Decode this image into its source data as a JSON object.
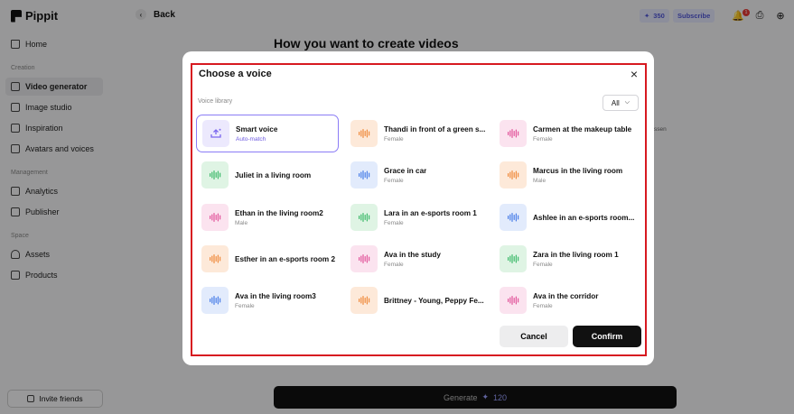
{
  "app": {
    "logo_text": "Pippit",
    "back_label": "Back",
    "credits": "350",
    "subscribe_label": "Subscribe",
    "notification_count": "1",
    "page_title": "How you want to create videos",
    "generate_label": "Generate",
    "generate_cost": "120",
    "invite_label": "Invite friends",
    "side_peek_text": "ssen"
  },
  "sidebar": {
    "home": "Home",
    "creation_section": "Creation",
    "creation": [
      {
        "label": "Video generator",
        "icon": "video-icon",
        "active": true
      },
      {
        "label": "Image studio",
        "icon": "image-icon",
        "active": false
      },
      {
        "label": "Inspiration",
        "icon": "inspiration-icon",
        "active": false
      },
      {
        "label": "Avatars and voices",
        "icon": "avatar-icon",
        "active": false
      }
    ],
    "management_section": "Management",
    "management": [
      {
        "label": "Analytics",
        "icon": "analytics-icon"
      },
      {
        "label": "Publisher",
        "icon": "calendar-icon"
      }
    ],
    "space_section": "Space",
    "space": [
      {
        "label": "Assets",
        "icon": "assets-icon"
      },
      {
        "label": "Products",
        "icon": "products-icon"
      }
    ]
  },
  "modal": {
    "title": "Choose a voice",
    "library_label": "Voice library",
    "filter_value": "All",
    "cancel_label": "Cancel",
    "confirm_label": "Confirm",
    "voices": [
      {
        "name": "Smart voice",
        "sub": "Auto-match",
        "color": "purple",
        "selected": true
      },
      {
        "name": "Thandi in front of a green s...",
        "sub": "Female",
        "color": "orange"
      },
      {
        "name": "Carmen at the makeup table",
        "sub": "Female",
        "color": "pink"
      },
      {
        "name": "Juliet in a living room",
        "sub": "",
        "color": "green"
      },
      {
        "name": "Grace in car",
        "sub": "Female",
        "color": "blue"
      },
      {
        "name": "Marcus in the living room",
        "sub": "Male",
        "color": "orange"
      },
      {
        "name": "Ethan in the living room2",
        "sub": "Male",
        "color": "pink"
      },
      {
        "name": "Lara in an e-sports room 1",
        "sub": "Female",
        "color": "green"
      },
      {
        "name": "Ashlee in an e-sports room...",
        "sub": "",
        "color": "blue"
      },
      {
        "name": "Esther in an e-sports room 2",
        "sub": "",
        "color": "orange"
      },
      {
        "name": "Ava in the study",
        "sub": "Female",
        "color": "pink"
      },
      {
        "name": "Zara in the living room 1",
        "sub": "Female",
        "color": "green"
      },
      {
        "name": "Ava in the living room3",
        "sub": "Female",
        "color": "blue"
      },
      {
        "name": "Brittney - Young, Peppy Fe...",
        "sub": "",
        "color": "orange"
      },
      {
        "name": "Ava in the corridor",
        "sub": "Female",
        "color": "pink"
      }
    ]
  },
  "colors": {
    "purple_bg": "#ece9fd",
    "purple_fg": "#7b68ee",
    "orange_bg": "#fde9d9",
    "orange_fg": "#f08a3c",
    "pink_bg": "#fbe3ef",
    "pink_fg": "#e2559b",
    "green_bg": "#dff4e4",
    "green_fg": "#3dba6a",
    "blue_bg": "#e2ebfc",
    "blue_fg": "#4a7ee8",
    "frame_red": "#d71920"
  }
}
